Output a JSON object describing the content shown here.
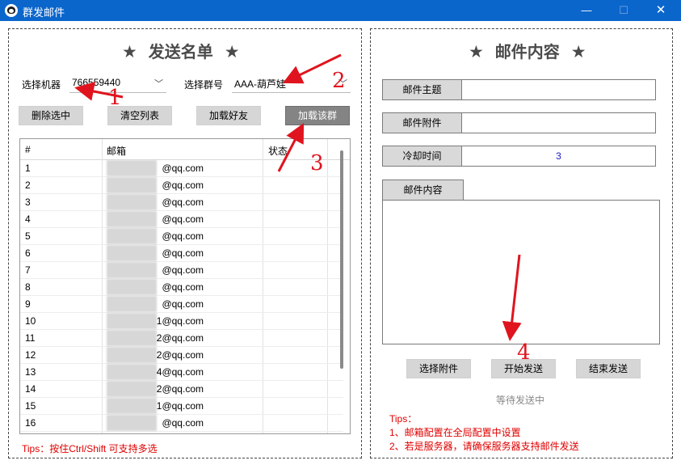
{
  "window": {
    "title": "群发邮件",
    "min_glyph": "—",
    "max_glyph": "☐",
    "close_glyph": "✕"
  },
  "left": {
    "title": "发送名单",
    "star": "★",
    "robot_label": "选择机器",
    "robot_value": "766559440",
    "group_label": "选择群号",
    "group_value": "AAA-葫芦娃",
    "buttons": {
      "delete": "删除选中",
      "clear": "清空列表",
      "load_friends": "加载好友",
      "load_group": "加载该群"
    },
    "columns": [
      "#",
      "邮箱",
      "状态"
    ],
    "rows": [
      {
        "n": "1",
        "email": "@qq.com"
      },
      {
        "n": "2",
        "email": "@qq.com"
      },
      {
        "n": "3",
        "email": "@qq.com"
      },
      {
        "n": "4",
        "email": "@qq.com"
      },
      {
        "n": "5",
        "email": "@qq.com"
      },
      {
        "n": "6",
        "email": "@qq.com"
      },
      {
        "n": "7",
        "email": "@qq.com"
      },
      {
        "n": "8",
        "email": "@qq.com"
      },
      {
        "n": "9",
        "email": "@qq.com"
      },
      {
        "n": "10",
        "email": "1@qq.com"
      },
      {
        "n": "11",
        "email": "2@qq.com"
      },
      {
        "n": "12",
        "email": "2@qq.com"
      },
      {
        "n": "13",
        "email": "4@qq.com"
      },
      {
        "n": "14",
        "email": "2@qq.com"
      },
      {
        "n": "15",
        "email": "1@qq.com"
      },
      {
        "n": "16",
        "email": "@qq.com"
      }
    ],
    "tips": "Tips：按住Ctrl/Shift 可支持多选"
  },
  "right": {
    "title": "邮件内容",
    "star": "★",
    "subject_label": "邮件主题",
    "subject_value": "",
    "attach_label": "邮件附件",
    "attach_value": "",
    "cooldown_label": "冷却时间",
    "cooldown_value": "3",
    "content_label": "邮件内容",
    "content_value": "",
    "buttons": {
      "select_attach": "选择附件",
      "start": "开始发送",
      "stop": "结束发送"
    },
    "status": "等待发送中",
    "tips_title": "Tips：",
    "tips": [
      "1、邮箱配置在全局配置中设置",
      "2、若是服务器，请确保服务器支持邮件发送"
    ]
  },
  "annotations": {
    "n1": "1",
    "n2": "2",
    "n3": "3",
    "n4": "4",
    "color": "#e0141e"
  }
}
